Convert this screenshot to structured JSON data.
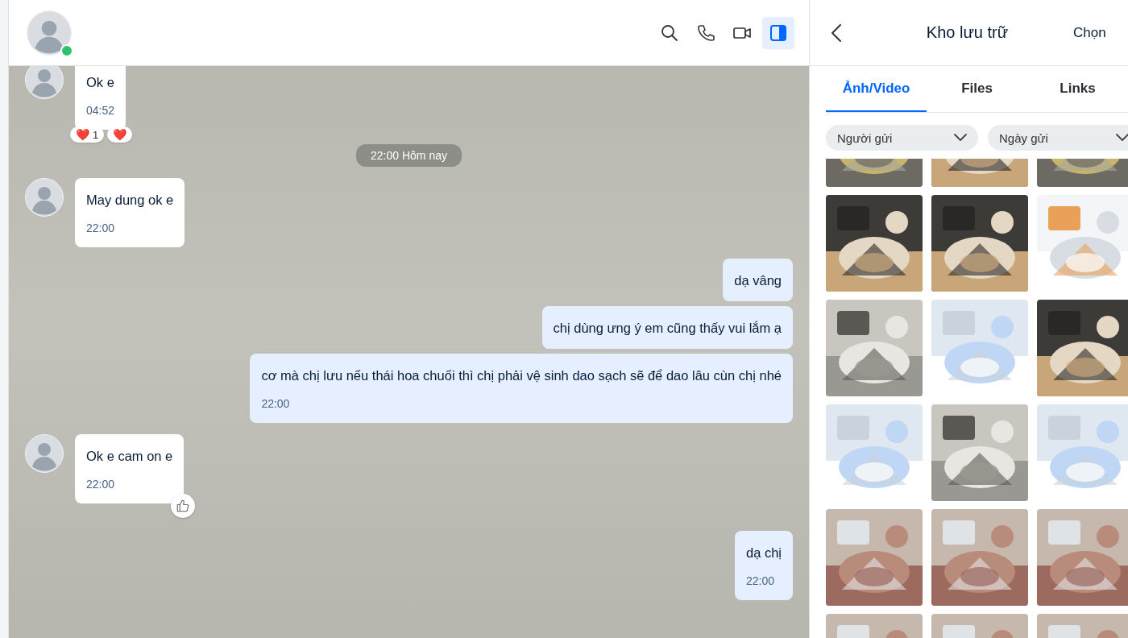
{
  "chat_header": {
    "online": true
  },
  "messages": [
    {
      "kind": "received",
      "text": "Ok e",
      "time": "04:52",
      "like_button": false,
      "reactions": [
        {
          "emoji": "❤️",
          "count": "1"
        },
        {
          "emoji": "❤️"
        }
      ]
    },
    {
      "kind": "date",
      "text": "22:00 Hôm nay"
    },
    {
      "kind": "received",
      "text": "May dung ok e",
      "time": "22:00",
      "like_button": false
    },
    {
      "kind": "sent",
      "text": "dạ vâng",
      "like_button": false
    },
    {
      "kind": "sent",
      "text": "chị dùng ưng ý em cũng thấy vui lắm ạ",
      "like_button": false
    },
    {
      "kind": "sent",
      "text": "cơ mà chị lưu nếu thái hoa chuối thì chị phải vệ sinh dao sạch sẽ để dao lâu cùn chị nhé",
      "time": "22:00",
      "like_button": false
    },
    {
      "kind": "received",
      "text": "Ok e cam on e",
      "time": "22:00",
      "like_button": true
    },
    {
      "kind": "sent",
      "text": "dạ chị",
      "time": "22:00",
      "like_button": false
    }
  ],
  "storage_panel": {
    "title": "Kho lưu trữ",
    "select_button": "Chọn",
    "tabs": [
      {
        "label": "Ảnh/Video",
        "selected": true
      },
      {
        "label": "Files",
        "selected": false
      },
      {
        "label": "Links",
        "selected": false
      }
    ],
    "filters": [
      {
        "label": "Người gửi"
      },
      {
        "label": "Ngày gửi"
      }
    ]
  }
}
